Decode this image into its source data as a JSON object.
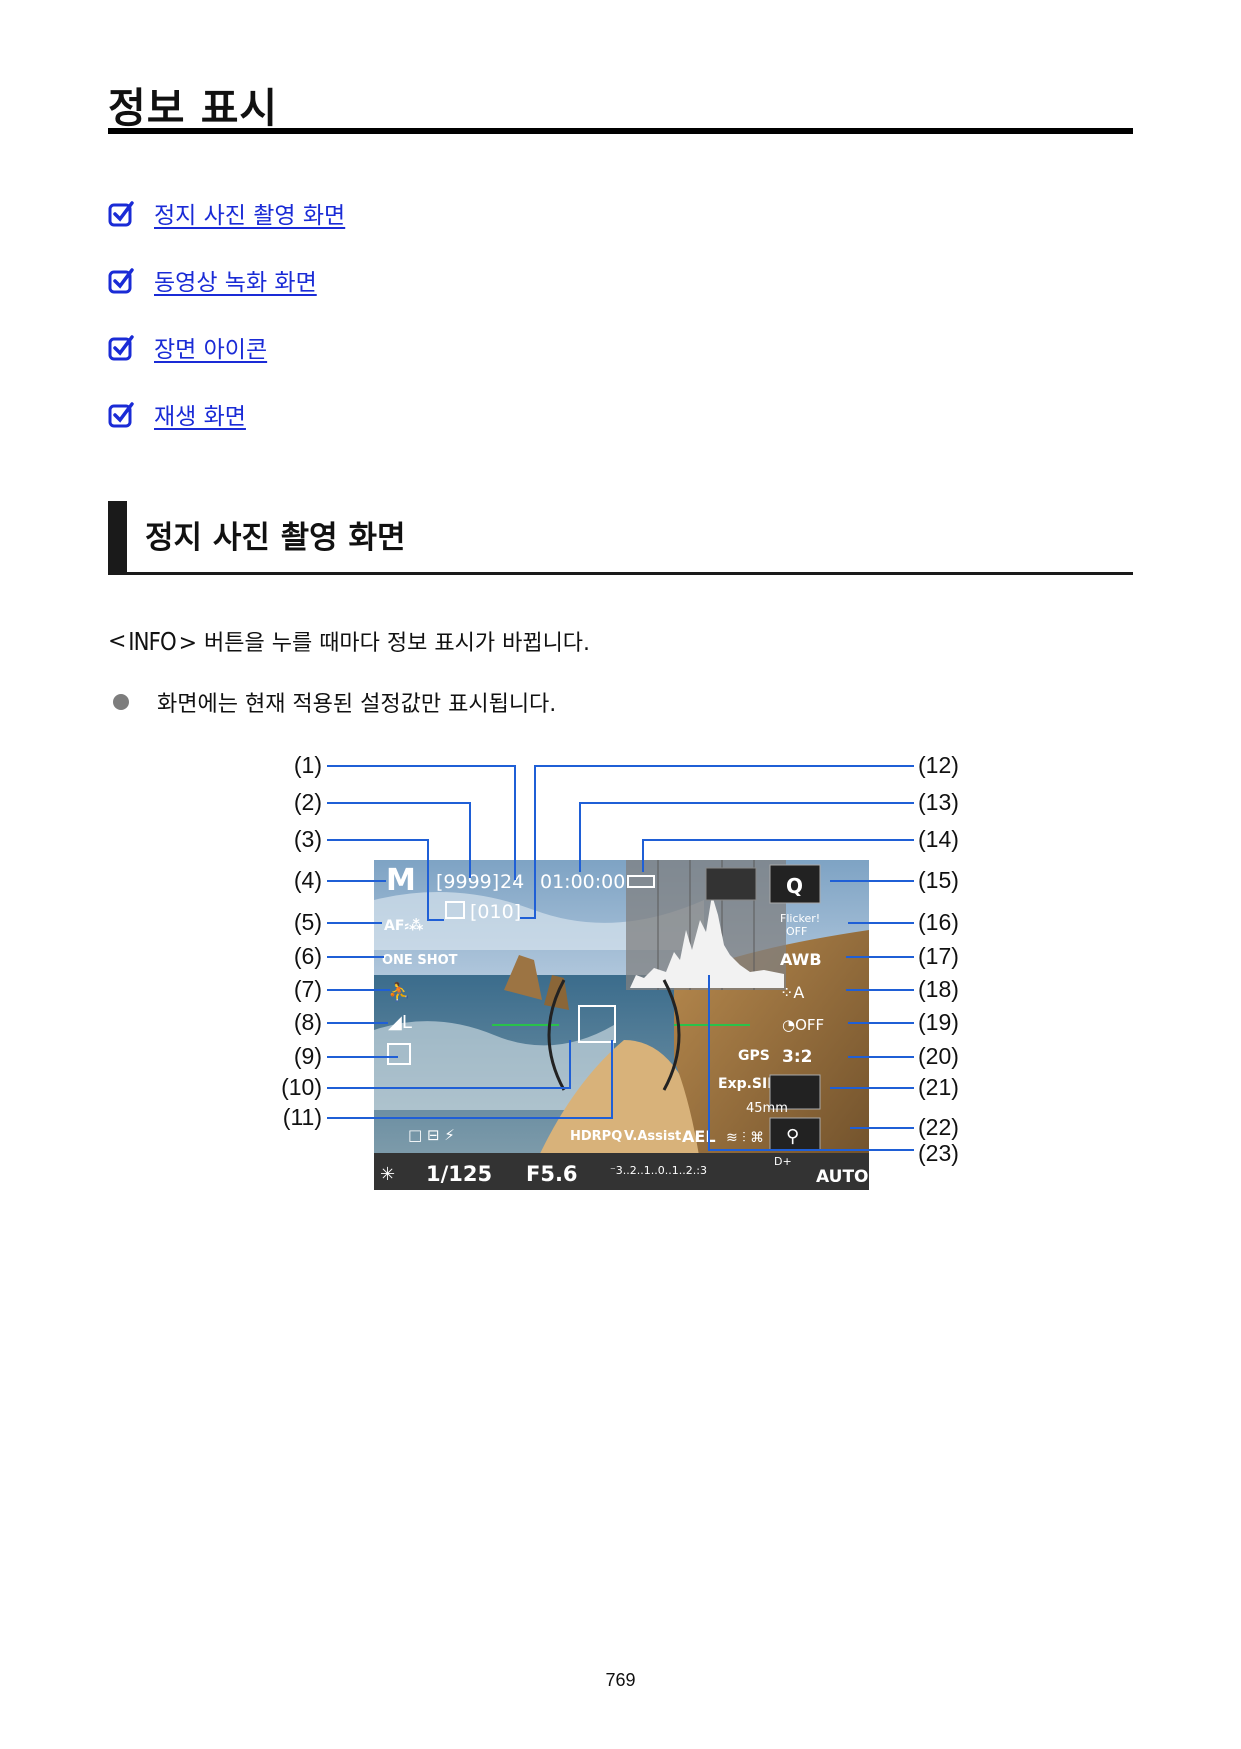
{
  "page": {
    "title": "정보 표시",
    "number": "769"
  },
  "toc": [
    {
      "label": "정지 사진 촬영 화면",
      "icon": "checkbox-link-icon"
    },
    {
      "label": "동영상 녹화 화면",
      "icon": "checkbox-link-icon"
    },
    {
      "label": "장면 아이콘",
      "icon": "checkbox-link-icon"
    },
    {
      "label": "재생 화면",
      "icon": "checkbox-link-icon"
    }
  ],
  "section": {
    "title": "정지 사진 촬영 화면",
    "intro_prefix": "<",
    "intro_button": "INFO",
    "intro_suffix": "> 버튼을 누를 때마다 정보 표시가 바뀝니다.",
    "note": "화면에는 현재 적용된 설정값만 표시됩니다."
  },
  "colors": {
    "link": "#1a2bd6",
    "callout_line": "#1f5fd6",
    "af_frame_line": "#29c24a"
  },
  "screen": {
    "mode": "M",
    "shots": "[9999]",
    "burst": "24",
    "timer": "01:00:00",
    "frames": "[010]",
    "af_op": "ONE SHOT",
    "quick": "Q",
    "flicker_top": "Flicker!",
    "flicker_bottom": "OFF",
    "wb": "AWB",
    "gps": "GPS",
    "ratio": "3:2",
    "expsim": "Exp.SIM",
    "focal": "45mm",
    "hdr": "HDRPQ",
    "vassist": "V.Assist",
    "ael": "AEL",
    "shutter": "1/125",
    "aperture": "F5.6",
    "exposure_scale": "⁻3..2..1..0..1..2.:3",
    "iso": "AUTO",
    "d_plus": "D+"
  },
  "callouts": [
    "(1)",
    "(2)",
    "(3)",
    "(4)",
    "(5)",
    "(6)",
    "(7)",
    "(8)",
    "(9)",
    "(10)",
    "(11)",
    "(12)",
    "(13)",
    "(14)",
    "(15)",
    "(16)",
    "(17)",
    "(18)",
    "(19)",
    "(20)",
    "(21)",
    "(22)",
    "(23)"
  ]
}
